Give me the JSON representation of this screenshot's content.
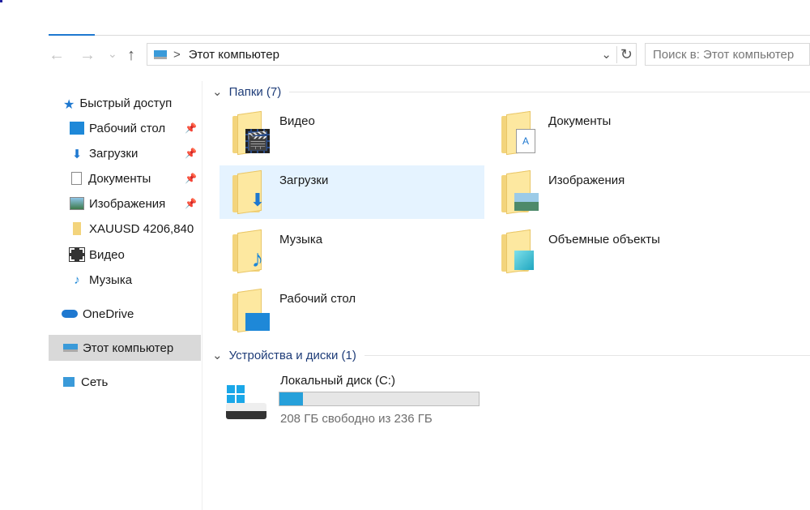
{
  "toolbar": {
    "back": "←",
    "forward": "→",
    "recent": "⌄",
    "up": "↑",
    "refresh": "↻",
    "dropdown": "⌄"
  },
  "address": {
    "separator": ">",
    "path": "Этот компьютер"
  },
  "search": {
    "placeholder": "Поиск в: Этот компьютер"
  },
  "sidebar": {
    "items": [
      {
        "label": "Быстрый доступ"
      },
      {
        "label": "Рабочий стол"
      },
      {
        "label": "Загрузки"
      },
      {
        "label": "Документы"
      },
      {
        "label": "Изображения"
      },
      {
        "label": "XAUUSD 4206,840"
      },
      {
        "label": "Видео"
      },
      {
        "label": "Музыка"
      },
      {
        "label": "OneDrive"
      },
      {
        "label": "Этот компьютер"
      },
      {
        "label": "Сеть"
      }
    ]
  },
  "groups": {
    "folders": "Папки (7)",
    "devices": "Устройства и диски (1)"
  },
  "folders": [
    {
      "label": "Видео"
    },
    {
      "label": "Документы"
    },
    {
      "label": "Загрузки"
    },
    {
      "label": "Изображения"
    },
    {
      "label": "Музыка"
    },
    {
      "label": "Объемные объекты"
    },
    {
      "label": "Рабочий стол"
    }
  ],
  "drive": {
    "label": "Локальный диск (C:)",
    "status": "208 ГБ свободно из 236 ГБ",
    "used_fraction": 0.119
  },
  "colors": {
    "accent": "#1e78d0",
    "bar": "#26a0da",
    "selection": "#e5f3ff"
  }
}
